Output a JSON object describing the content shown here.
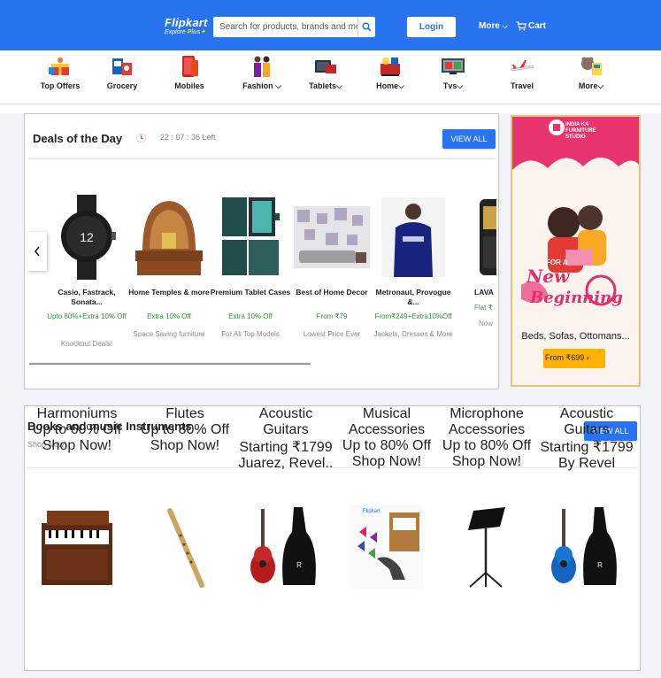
{
  "header": {
    "logo_text": "Flipkart",
    "logo_tag_prefix": "Explore",
    "logo_tag_plus": "Plus",
    "search_placeholder": "Search for products, brands and more",
    "login_label": "Login",
    "more_label": "More",
    "cart_label": "Cart",
    "brand_color": "#2874f0"
  },
  "categories": [
    {
      "label": "Top Offers",
      "icon": "offers-icon"
    },
    {
      "label": "Grocery",
      "icon": "grocery-icon"
    },
    {
      "label": "Mobiles",
      "icon": "mobiles-icon"
    },
    {
      "label": "Fashion",
      "icon": "fashion-icon",
      "dropdown": true
    },
    {
      "label": "Tablets",
      "icon": "tablets-icon",
      "dropdown": true
    },
    {
      "label": "Home",
      "icon": "home-icon",
      "dropdown": true
    },
    {
      "label": "Tvs",
      "icon": "tvs-icon",
      "dropdown": true
    },
    {
      "label": "Travel",
      "icon": "travel-icon"
    },
    {
      "label": "More",
      "icon": "more-icon",
      "dropdown": true
    }
  ],
  "deals": {
    "title": "Deals of the Day",
    "timer": "22 : 07 : 36 Left",
    "view_all": "VIEW ALL",
    "items": [
      {
        "name": "Casio, Fastrack, Sonata...",
        "offer": "Upto 80%+Extra 10% Off",
        "sub": "Knockout Deals!"
      },
      {
        "name": "Home Temples & more",
        "offer": "Extra 10% Off",
        "sub": "Space Saving furniture"
      },
      {
        "name": "Premium Tablet Cases",
        "offer": "Extra 10% Off",
        "sub": "For All Top Models"
      },
      {
        "name": "Best of Home Decor",
        "offer": "From ₹79",
        "sub": "Lowest Price Ever"
      },
      {
        "name": "Metronaut, Provogue &...",
        "offer": "From₹249+Extra10%Off",
        "sub": "Jackets, Dresses & More"
      },
      {
        "name": "LAVA",
        "offer": "Flat ₹",
        "sub": "Now"
      }
    ]
  },
  "ad": {
    "brand_line1": "INDIA KA",
    "brand_line2": "FURNITURE",
    "brand_line3": "STUDIO",
    "for_a": "FOR A",
    "headline1": "New",
    "headline2": "Beginning",
    "subtext": "Beds, Sofas, Ottomans...",
    "cta": "From ₹699"
  },
  "books": {
    "title": "Books and music Instruments",
    "subtitle": "Shop Now!",
    "view_all": "VIEW ALL",
    "items": [
      {
        "name": "Harmoniums",
        "offer": "Up to 60% Off",
        "sub": "Shop Now!"
      },
      {
        "name": "Flutes",
        "offer": "Up to 80% Off",
        "sub": "Shop Now!"
      },
      {
        "name": "Acoustic Guitars",
        "offer": "Starting ₹1799",
        "sub": "Juarez, Revel.."
      },
      {
        "name": "Musical Accessories",
        "offer": "Up to 80% Off",
        "sub": "Shop Now!"
      },
      {
        "name": "Microphone Accessories",
        "offer": "Up to 80% Off",
        "sub": "Shop Now!"
      },
      {
        "name": "Acoustic Guitars",
        "offer": "Starting ₹1799",
        "sub": "By Revel"
      }
    ]
  }
}
